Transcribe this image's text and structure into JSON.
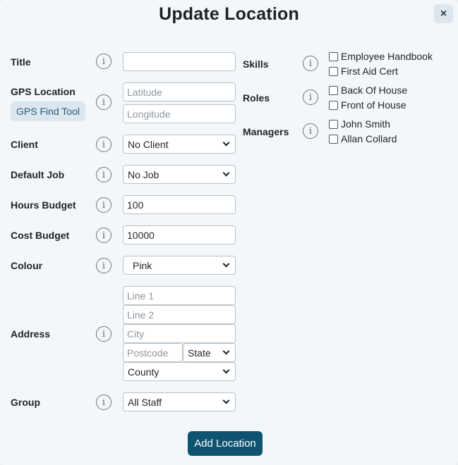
{
  "modal": {
    "title": "Update Location",
    "close_label": "×"
  },
  "info_glyph": "i",
  "form": {
    "title": {
      "label": "Title",
      "value": ""
    },
    "gps": {
      "label": "GPS Location",
      "tool_label": "GPS Find Tool",
      "latitude_placeholder": "Latitude",
      "longitude_placeholder": "Longitude"
    },
    "client": {
      "label": "Client",
      "selected": "No Client"
    },
    "default_job": {
      "label": "Default Job",
      "selected": "No Job"
    },
    "hours_budget": {
      "label": "Hours Budget",
      "value": "100"
    },
    "cost_budget": {
      "label": "Cost Budget",
      "value": "10000"
    },
    "colour": {
      "label": "Colour",
      "selected": "Pink"
    },
    "address": {
      "label": "Address",
      "line1_placeholder": "Line 1",
      "line2_placeholder": "Line 2",
      "city_placeholder": "City",
      "postcode_placeholder": "Postcode",
      "state_selected": "State",
      "county_selected": "County"
    },
    "group": {
      "label": "Group",
      "selected": "All Staff"
    }
  },
  "right": {
    "skills": {
      "label": "Skills",
      "options": [
        "Employee Handbook",
        "First Aid Cert"
      ]
    },
    "roles": {
      "label": "Roles",
      "options": [
        "Back Of House",
        "Front of House"
      ]
    },
    "managers": {
      "label": "Managers",
      "options": [
        "John Smith",
        "Allan Collard"
      ]
    }
  },
  "submit_label": "Add Location",
  "colors": {
    "modal_bg": "#f3f7fa",
    "primary_button": "#0e5470",
    "secondary_button_bg": "#dbe6ee",
    "secondary_button_text": "#2c5e7c"
  }
}
